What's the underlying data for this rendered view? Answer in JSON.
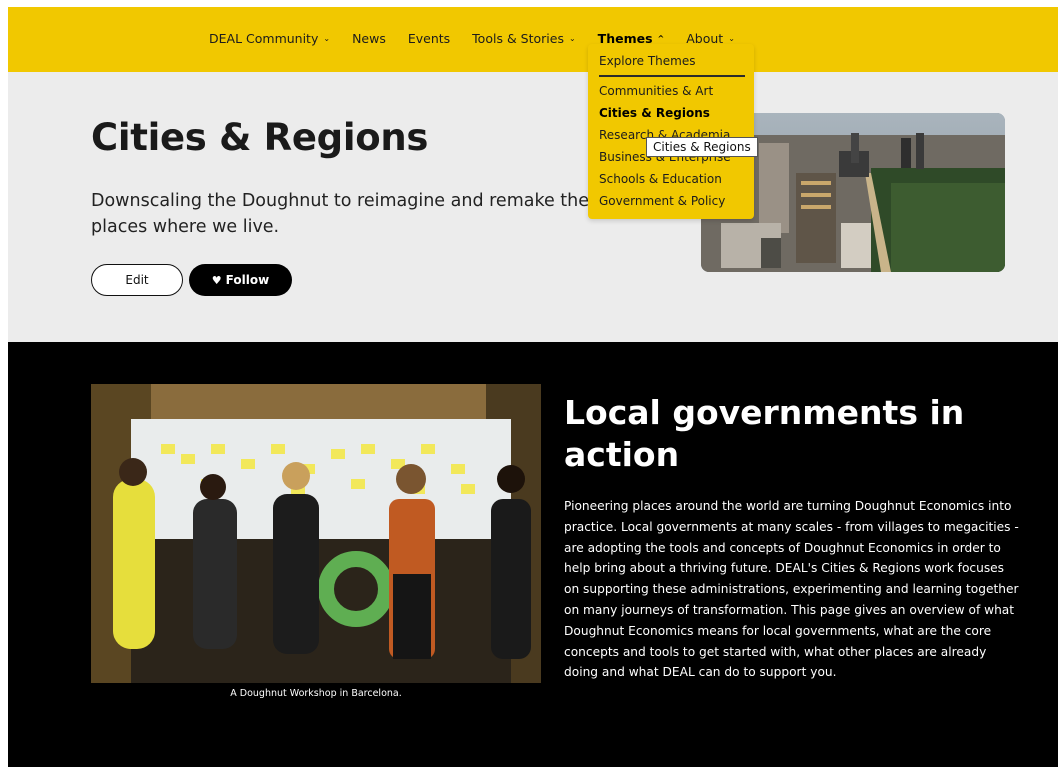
{
  "nav": {
    "items": [
      {
        "label": "DEAL Community",
        "chevron": "⌄",
        "active": false
      },
      {
        "label": "News",
        "chevron": "",
        "active": false
      },
      {
        "label": "Events",
        "chevron": "",
        "active": false
      },
      {
        "label": "Tools & Stories",
        "chevron": "⌄",
        "active": false
      },
      {
        "label": "Themes",
        "chevron": "^",
        "active": true
      },
      {
        "label": "About",
        "chevron": "⌄",
        "active": false
      }
    ]
  },
  "themes_dropdown": {
    "header": "Explore Themes",
    "items": [
      {
        "label": "Communities & Art",
        "selected": false
      },
      {
        "label": "Cities & Regions",
        "selected": true
      },
      {
        "label": "Research & Academia",
        "selected": false
      },
      {
        "label": "Business & Enterprise",
        "selected": false
      },
      {
        "label": "Schools & Education",
        "selected": false
      },
      {
        "label": "Government & Policy",
        "selected": false
      }
    ],
    "tooltip": "Cities & Regions"
  },
  "hero": {
    "title": "Cities & Regions",
    "subtitle": "Downscaling the Doughnut to reimagine and remake the places where we live.",
    "edit_label": "Edit",
    "follow_label": "Follow",
    "follow_icon": "heart-icon"
  },
  "section": {
    "title": "Local governments in action",
    "body": "Pioneering places around the world are turning Doughnut Economics into practice. Local governments at many scales - from villages to megacities - are adopting the tools and concepts of Doughnut Economics in order to help bring about a thriving future. DEAL's Cities & Regions work focuses on supporting these administrations, experimenting and learning together on many journeys of transformation. This page gives an overview of what Doughnut Economics means for local governments, what are the core concepts and tools to get started with, what other places are already doing and what DEAL can do to support you.",
    "image_caption": "A Doughnut Workshop in Barcelona."
  },
  "colors": {
    "brand_yellow": "#f1c800",
    "hero_bg": "#ececec",
    "dark_bg": "#000000"
  }
}
